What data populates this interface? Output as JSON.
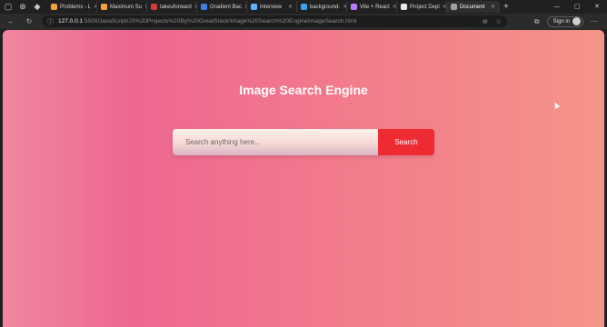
{
  "browser": {
    "tabs": [
      {
        "label": "Problems - L",
        "color": "#f2a33a"
      },
      {
        "label": "Maximum Su",
        "color": "#f2a33a"
      },
      {
        "label": "takeuforward",
        "color": "#d23b3b"
      },
      {
        "label": "Gradient Bac",
        "color": "#3b7fe0"
      },
      {
        "label": "Interview",
        "color": "#5fb0ff"
      },
      {
        "label": "background-",
        "color": "#37a5e8"
      },
      {
        "label": "Vite + React",
        "color": "#b57cff"
      },
      {
        "label": "Project Depl",
        "color": "#e8e8e8"
      },
      {
        "label": "Document",
        "color": "#9aa0a6",
        "active": true
      }
    ],
    "url_host": "127.0.0.1",
    "url_path": ":5500/JavaScript/JS%20Projects%20By%20GreatStack/Image%20Search%20Engine/imageSearch.html",
    "signin_label": "Sign in"
  },
  "page": {
    "title": "Image Search Engine",
    "search_placeholder": "Search anything here...",
    "search_button": "Search"
  },
  "colors": {
    "button": "#ee2a33",
    "gradient_start": "#f0869f",
    "gradient_end": "#f59489"
  }
}
